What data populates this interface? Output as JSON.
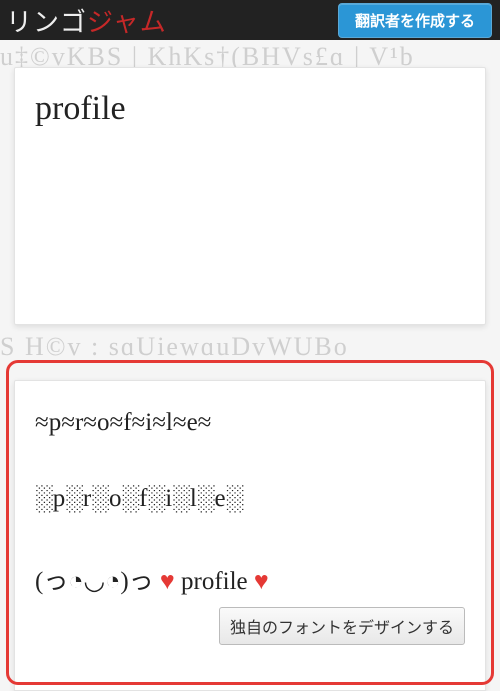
{
  "header": {
    "logo_a": "リンゴ",
    "logo_b": "ジャム",
    "button": "翻訳者を作成する"
  },
  "bg": {
    "line1": "u‡©vKBS | KhKs†(BHVs£ɑ | V¹b",
    "line2": "  S H©v : sɑUiewɑuDvWUBo"
  },
  "input": {
    "text": "profile"
  },
  "output": {
    "line1": "≈p≈r≈o≈f≈i≈l≈e≈",
    "line2": "░p░r░o░f░i░l░e░",
    "line3_pre": "(っ◔◡◔)っ ",
    "line3_heart": "♥",
    "line3_mid": " profile ",
    "design_button": "独自のフォントをデザインする"
  }
}
